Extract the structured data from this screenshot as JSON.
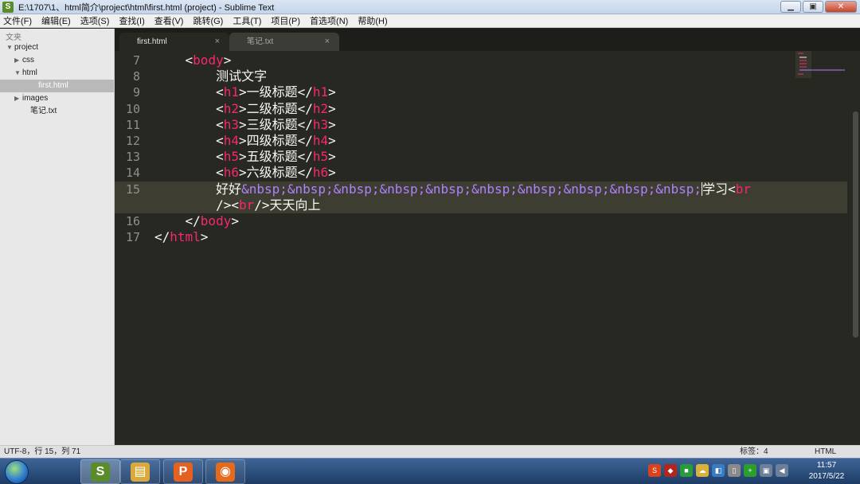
{
  "window": {
    "title": "E:\\1707\\1、html简介\\project\\html\\first.html (project) - Sublime Text",
    "app_icon_letter": "S",
    "minimize_glyph": "▁",
    "maximize_glyph": "▣",
    "close_glyph": "✕"
  },
  "menu": [
    "文件(F)",
    "编辑(E)",
    "选项(S)",
    "查找(I)",
    "查看(V)",
    "跳转(G)",
    "工具(T)",
    "项目(P)",
    "首选项(N)",
    "帮助(H)"
  ],
  "sidebar": {
    "header": "文夹",
    "tree": [
      {
        "label": "project",
        "arrow": "▼",
        "indent": 0,
        "selected": false
      },
      {
        "label": "css",
        "arrow": "▶",
        "indent": 1,
        "selected": false
      },
      {
        "label": "html",
        "arrow": "▼",
        "indent": 1,
        "selected": false
      },
      {
        "label": "first.html",
        "arrow": "",
        "indent": 3,
        "selected": true
      },
      {
        "label": "images",
        "arrow": "▶",
        "indent": 1,
        "selected": false
      },
      {
        "label": "笔记.txt",
        "arrow": "",
        "indent": 2,
        "selected": false
      }
    ]
  },
  "tabs": [
    {
      "label": "first.html",
      "active": true,
      "close": "×"
    },
    {
      "label": "笔记.txt",
      "active": false,
      "close": "×"
    }
  ],
  "editor": {
    "current_line": "15",
    "lines": [
      {
        "n": "7",
        "indent": "    ",
        "tokens": [
          [
            "p",
            "<"
          ],
          [
            "t",
            "body"
          ],
          [
            "p",
            ">"
          ]
        ]
      },
      {
        "n": "8",
        "indent": "        ",
        "tokens": [
          [
            "x",
            "测试文字"
          ]
        ]
      },
      {
        "n": "9",
        "indent": "        ",
        "tokens": [
          [
            "p",
            "<"
          ],
          [
            "t",
            "h1"
          ],
          [
            "p",
            ">"
          ],
          [
            "x",
            "一级标题"
          ],
          [
            "p",
            "</"
          ],
          [
            "t",
            "h1"
          ],
          [
            "p",
            ">"
          ]
        ]
      },
      {
        "n": "10",
        "indent": "        ",
        "tokens": [
          [
            "p",
            "<"
          ],
          [
            "t",
            "h2"
          ],
          [
            "p",
            ">"
          ],
          [
            "x",
            "二级标题"
          ],
          [
            "p",
            "</"
          ],
          [
            "t",
            "h2"
          ],
          [
            "p",
            ">"
          ]
        ]
      },
      {
        "n": "11",
        "indent": "        ",
        "tokens": [
          [
            "p",
            "<"
          ],
          [
            "t",
            "h3"
          ],
          [
            "p",
            ">"
          ],
          [
            "x",
            "三级标题"
          ],
          [
            "p",
            "</"
          ],
          [
            "t",
            "h3"
          ],
          [
            "p",
            ">"
          ]
        ]
      },
      {
        "n": "12",
        "indent": "        ",
        "tokens": [
          [
            "p",
            "<"
          ],
          [
            "t",
            "h4"
          ],
          [
            "p",
            ">"
          ],
          [
            "x",
            "四级标题"
          ],
          [
            "p",
            "</"
          ],
          [
            "t",
            "h4"
          ],
          [
            "p",
            ">"
          ]
        ]
      },
      {
        "n": "13",
        "indent": "        ",
        "tokens": [
          [
            "p",
            "<"
          ],
          [
            "t",
            "h5"
          ],
          [
            "p",
            ">"
          ],
          [
            "x",
            "五级标题"
          ],
          [
            "p",
            "</"
          ],
          [
            "t",
            "h5"
          ],
          [
            "p",
            ">"
          ]
        ]
      },
      {
        "n": "14",
        "indent": "        ",
        "tokens": [
          [
            "p",
            "<"
          ],
          [
            "t",
            "h6"
          ],
          [
            "p",
            ">"
          ],
          [
            "x",
            "六级标题"
          ],
          [
            "p",
            "</"
          ],
          [
            "t",
            "h6"
          ],
          [
            "p",
            ">"
          ]
        ]
      },
      {
        "n": "15",
        "indent": "        ",
        "tokens": [
          [
            "x",
            "好好"
          ],
          [
            "e",
            "&nbsp;&nbsp;&nbsp;&nbsp;&nbsp;&nbsp;&nbsp;&nbsp;&nbsp;&nbsp;"
          ],
          [
            "c",
            ""
          ],
          [
            "x",
            "学习"
          ],
          [
            "p",
            "<"
          ],
          [
            "t",
            "br"
          ]
        ]
      },
      {
        "n": "",
        "indent": "        ",
        "tokens": [
          [
            "p",
            "/><"
          ],
          [
            "t",
            "br"
          ],
          [
            "p",
            "/>"
          ],
          [
            "x",
            "天天向上"
          ]
        ]
      },
      {
        "n": "16",
        "indent": "    ",
        "tokens": [
          [
            "p",
            "</"
          ],
          [
            "t",
            "body"
          ],
          [
            "p",
            ">"
          ]
        ]
      },
      {
        "n": "17",
        "indent": "",
        "tokens": [
          [
            "p",
            "</"
          ],
          [
            "t",
            "html"
          ],
          [
            "p",
            ">"
          ]
        ]
      }
    ]
  },
  "status": {
    "position": "UTF-8，行 15，列 71",
    "tab_size": "标签：4",
    "syntax": "HTML"
  },
  "taskbar": {
    "apps": [
      {
        "name": "sublime-text",
        "glyph": "S",
        "color": "#5b8c2a",
        "active": true
      },
      {
        "name": "file-explorer",
        "glyph": "▤",
        "color": "#d9a93a",
        "active": false
      },
      {
        "name": "presentation",
        "glyph": "P",
        "color": "#e5611f",
        "active": false
      },
      {
        "name": "firefox",
        "glyph": "◉",
        "color": "#e66a1a",
        "active": false
      }
    ],
    "tray": [
      {
        "name": "ime-icon",
        "glyph": "S",
        "color": "#d8421c"
      },
      {
        "name": "antivirus-icon",
        "glyph": "◆",
        "color": "#b3261e"
      },
      {
        "name": "colorful-icon",
        "glyph": "■",
        "color": "#2a9a3c"
      },
      {
        "name": "cloud-icon",
        "glyph": "☁",
        "color": "#d8b23b"
      },
      {
        "name": "app-icon",
        "glyph": "◧",
        "color": "#3a7cc4"
      },
      {
        "name": "device-icon",
        "glyph": "▯",
        "color": "#8a8a8a"
      },
      {
        "name": "plus-icon",
        "glyph": "+",
        "color": "#2c9e2c"
      },
      {
        "name": "network-icon",
        "glyph": "▣",
        "color": "#6d7f96"
      },
      {
        "name": "volume-icon",
        "glyph": "◀",
        "color": "#6d7f96"
      }
    ],
    "time": "11:57",
    "date": "2017/5/22"
  }
}
